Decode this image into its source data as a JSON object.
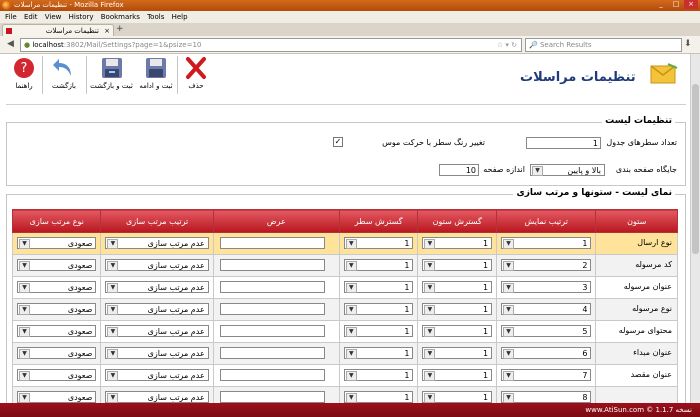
{
  "window": {
    "title": "تنظیمات مراسلات - Mozilla Firefox"
  },
  "menu": [
    "File",
    "Edit",
    "View",
    "History",
    "Bookmarks",
    "Tools",
    "Help"
  ],
  "tab": {
    "label": "تنظیمات مراسلات"
  },
  "nav": {
    "url_host": "localhost",
    "url_path": ":3802/Mail/Settings?page=1&psize=10",
    "search_placeholder": "Search Results"
  },
  "toolbar": {
    "delete": "حذف",
    "save_continue": "ثبت و ادامه",
    "save_return": "ثبت و بازگشت",
    "return": "بازگشت",
    "help": "راهنما"
  },
  "header": {
    "title": "تنظیمات مراسلات"
  },
  "list_settings": {
    "legend": "تنظیمات لیست",
    "rows_label": "تعداد سطرهای جدول",
    "rows_value": "1",
    "hover_label": "تغییر رنگ سطر با حرکت موس",
    "hover_checked": "✓",
    "paging_label": "جایگاه صفحه بندی",
    "paging_value": "بالا و پایین",
    "page_size_label": "اندازه صفحه",
    "page_size_value": "10"
  },
  "columns_section": {
    "legend": "نمای لیست - ستونها و مرتب سازی"
  },
  "table": {
    "headers": [
      "ستون",
      "ترتیب نمایش",
      "گسترش ستون",
      "گسترش سطر",
      "عرض",
      "ترتیب مرتب سازی",
      "نوع مرتب سازی"
    ],
    "rows": [
      {
        "name": "نوع ارسال",
        "order": "1",
        "col_span": "1",
        "row_span": "1",
        "width": "",
        "sort_order": "عدم مرتب سازی",
        "sort_type": "صعودی"
      },
      {
        "name": "کد مرسوله",
        "order": "2",
        "col_span": "1",
        "row_span": "1",
        "width": "",
        "sort_order": "عدم مرتب سازی",
        "sort_type": "صعودی"
      },
      {
        "name": "عنوان مرسوله",
        "order": "3",
        "col_span": "1",
        "row_span": "1",
        "width": "",
        "sort_order": "عدم مرتب سازی",
        "sort_type": "صعودی"
      },
      {
        "name": "نوع مرسوله",
        "order": "4",
        "col_span": "1",
        "row_span": "1",
        "width": "",
        "sort_order": "عدم مرتب سازی",
        "sort_type": "صعودی"
      },
      {
        "name": "محتوای مرسوله",
        "order": "5",
        "col_span": "1",
        "row_span": "1",
        "width": "",
        "sort_order": "عدم مرتب سازی",
        "sort_type": "صعودی"
      },
      {
        "name": "عنوان مبداء",
        "order": "6",
        "col_span": "1",
        "row_span": "1",
        "width": "",
        "sort_order": "عدم مرتب سازی",
        "sort_type": "صعودی"
      },
      {
        "name": "عنوان مقصد",
        "order": "7",
        "col_span": "1",
        "row_span": "1",
        "width": "",
        "sort_order": "عدم مرتب سازی",
        "sort_type": "صعودی"
      },
      {
        "name": "",
        "order": "8",
        "col_span": "1",
        "row_span": "1",
        "width": "",
        "sort_order": "عدم مرتب سازی",
        "sort_type": "صعودی"
      }
    ]
  },
  "status": {
    "text": "www.AtiSun.com © نسخه 1.1.7"
  }
}
